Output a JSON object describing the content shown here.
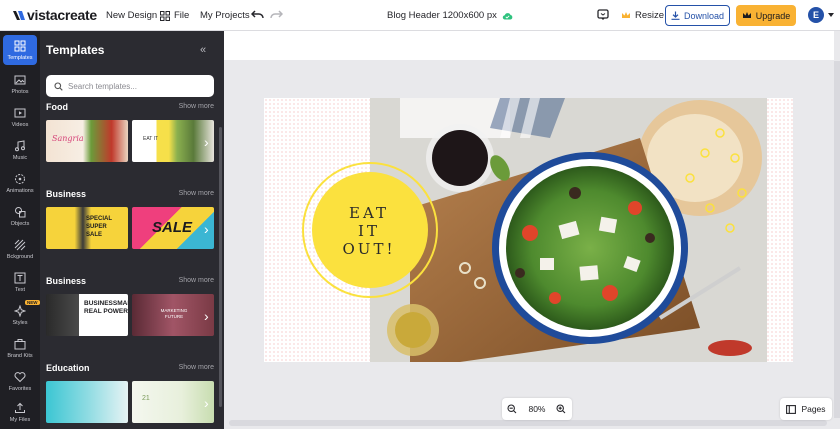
{
  "app": {
    "logo_text": "vistacreate",
    "nav": {
      "new_design": "New Design",
      "file": "File",
      "my_projects": "My Projects"
    },
    "doc_title": "Blog Header 1200x600 px",
    "resize": "Resize",
    "download": "Download",
    "upgrade": "Upgrade",
    "avatar_initial": "E"
  },
  "rail": {
    "items": [
      {
        "label": "Templates",
        "icon": "templates-icon"
      },
      {
        "label": "Photos",
        "icon": "photos-icon"
      },
      {
        "label": "Videos",
        "icon": "videos-icon"
      },
      {
        "label": "Music",
        "icon": "music-icon"
      },
      {
        "label": "Animations",
        "icon": "animations-icon"
      },
      {
        "label": "Objects",
        "icon": "objects-icon"
      },
      {
        "label": "Bckground",
        "icon": "background-icon"
      },
      {
        "label": "Text",
        "icon": "text-icon"
      },
      {
        "label": "Styles",
        "icon": "styles-icon",
        "badge": "NEW"
      },
      {
        "label": "Brand Kits",
        "icon": "brand-kits-icon"
      },
      {
        "label": "Favorites",
        "icon": "favorites-icon"
      },
      {
        "label": "My Files",
        "icon": "my-files-icon"
      }
    ]
  },
  "panel": {
    "title": "Templates",
    "search_placeholder": "Search templates...",
    "categories": [
      {
        "title": "Food",
        "more": "Show more",
        "thumb1_text": "Sangria",
        "thumb2_text": "EAT IT"
      },
      {
        "title": "Business",
        "more": "Show more",
        "thumb1_text": "SPECIAL SUPER SALE",
        "thumb2_text": "SALE"
      },
      {
        "title": "Business",
        "more": "Show more",
        "thumb1_text": "BUSINESSMAN REAL POWER",
        "thumb2_text": "MARKETING FUTURE"
      },
      {
        "title": "Education",
        "more": "Show more",
        "thumb1_text": "",
        "thumb2_text": "21"
      }
    ]
  },
  "canvas": {
    "headline": [
      "EAT",
      "IT",
      "OUT!"
    ],
    "colors": {
      "circle": "#fbe13e",
      "accent": "#f2b3b0"
    }
  },
  "footer": {
    "zoom": "80%",
    "pages": "Pages"
  },
  "colors": {
    "brand": "#2f6ae1",
    "upgrade": "#f9b233",
    "download": "#2451a8",
    "rail_bg": "#1f1f24",
    "panel_bg": "#2b2b31"
  }
}
